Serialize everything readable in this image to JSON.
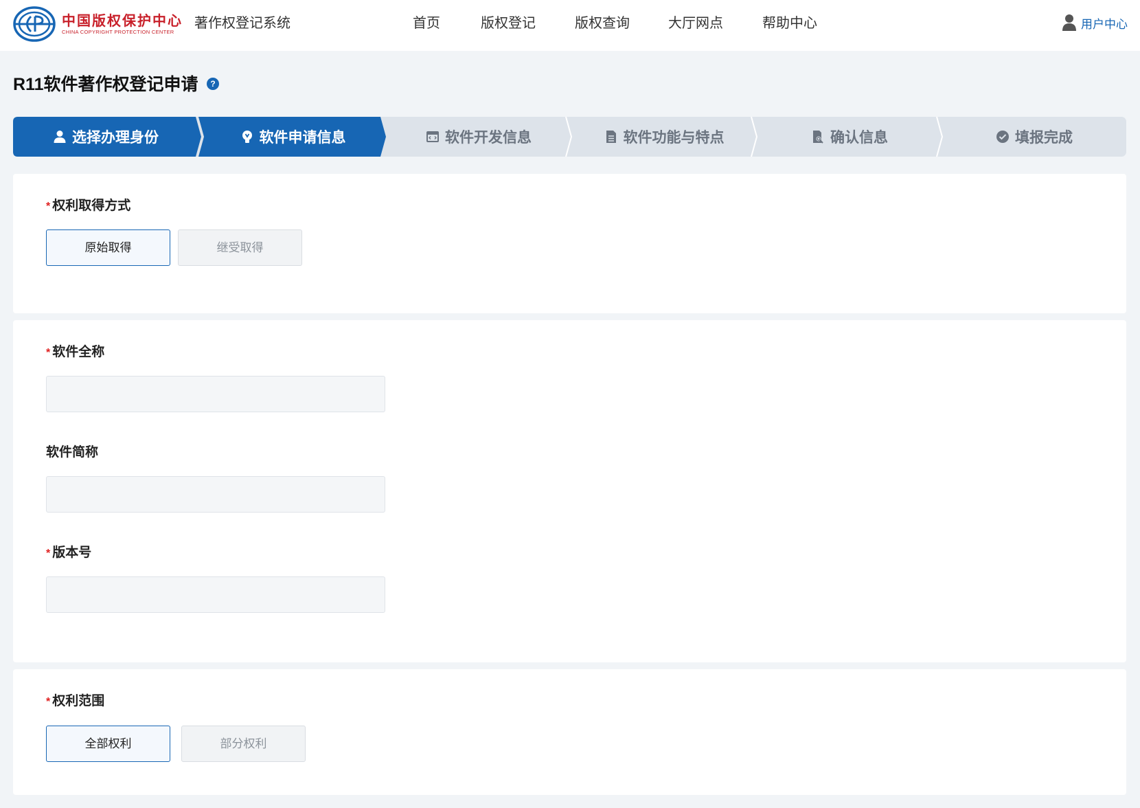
{
  "header": {
    "logo_cn": "中国版权保护中心",
    "logo_en": "CHINA COPYRIGHT PROTECTION CENTER",
    "system_name": "著作权登记系统",
    "nav": [
      "首页",
      "版权登记",
      "版权查询",
      "大厅网点",
      "帮助中心"
    ],
    "user_center": "用户中心"
  },
  "page": {
    "title": "R11软件著作权登记申请",
    "help_icon": "?"
  },
  "steps": [
    {
      "label": "选择办理身份",
      "icon": "user-icon",
      "state": "active"
    },
    {
      "label": "软件申请信息",
      "icon": "lightbulb-icon",
      "state": "active"
    },
    {
      "label": "软件开发信息",
      "icon": "code-window-icon",
      "state": "inactive"
    },
    {
      "label": "软件功能与特点",
      "icon": "document-icon",
      "state": "inactive"
    },
    {
      "label": "确认信息",
      "icon": "doc-search-icon",
      "state": "inactive"
    },
    {
      "label": "填报完成",
      "icon": "check-circle-icon",
      "state": "inactive"
    }
  ],
  "rights_acquisition": {
    "required_mark": "*",
    "label": "权利取得方式",
    "options": [
      "原始取得",
      "继受取得"
    ],
    "selected": "原始取得"
  },
  "software_info": {
    "full_name": {
      "required_mark": "*",
      "label": "软件全称",
      "value": "",
      "placeholder": ""
    },
    "short_name": {
      "label": "软件简称",
      "value": "",
      "placeholder": ""
    },
    "version": {
      "required_mark": "*",
      "label": "版本号",
      "value": "",
      "placeholder": ""
    }
  },
  "rights_scope": {
    "required_mark": "*",
    "label": "权利范围",
    "options": [
      "全部权利",
      "部分权利"
    ],
    "selected": "全部权利"
  },
  "colors": {
    "accent": "#1766b4",
    "step_inactive": "#dde3ea",
    "required": "#e02020",
    "logo_red": "#c8202a"
  }
}
